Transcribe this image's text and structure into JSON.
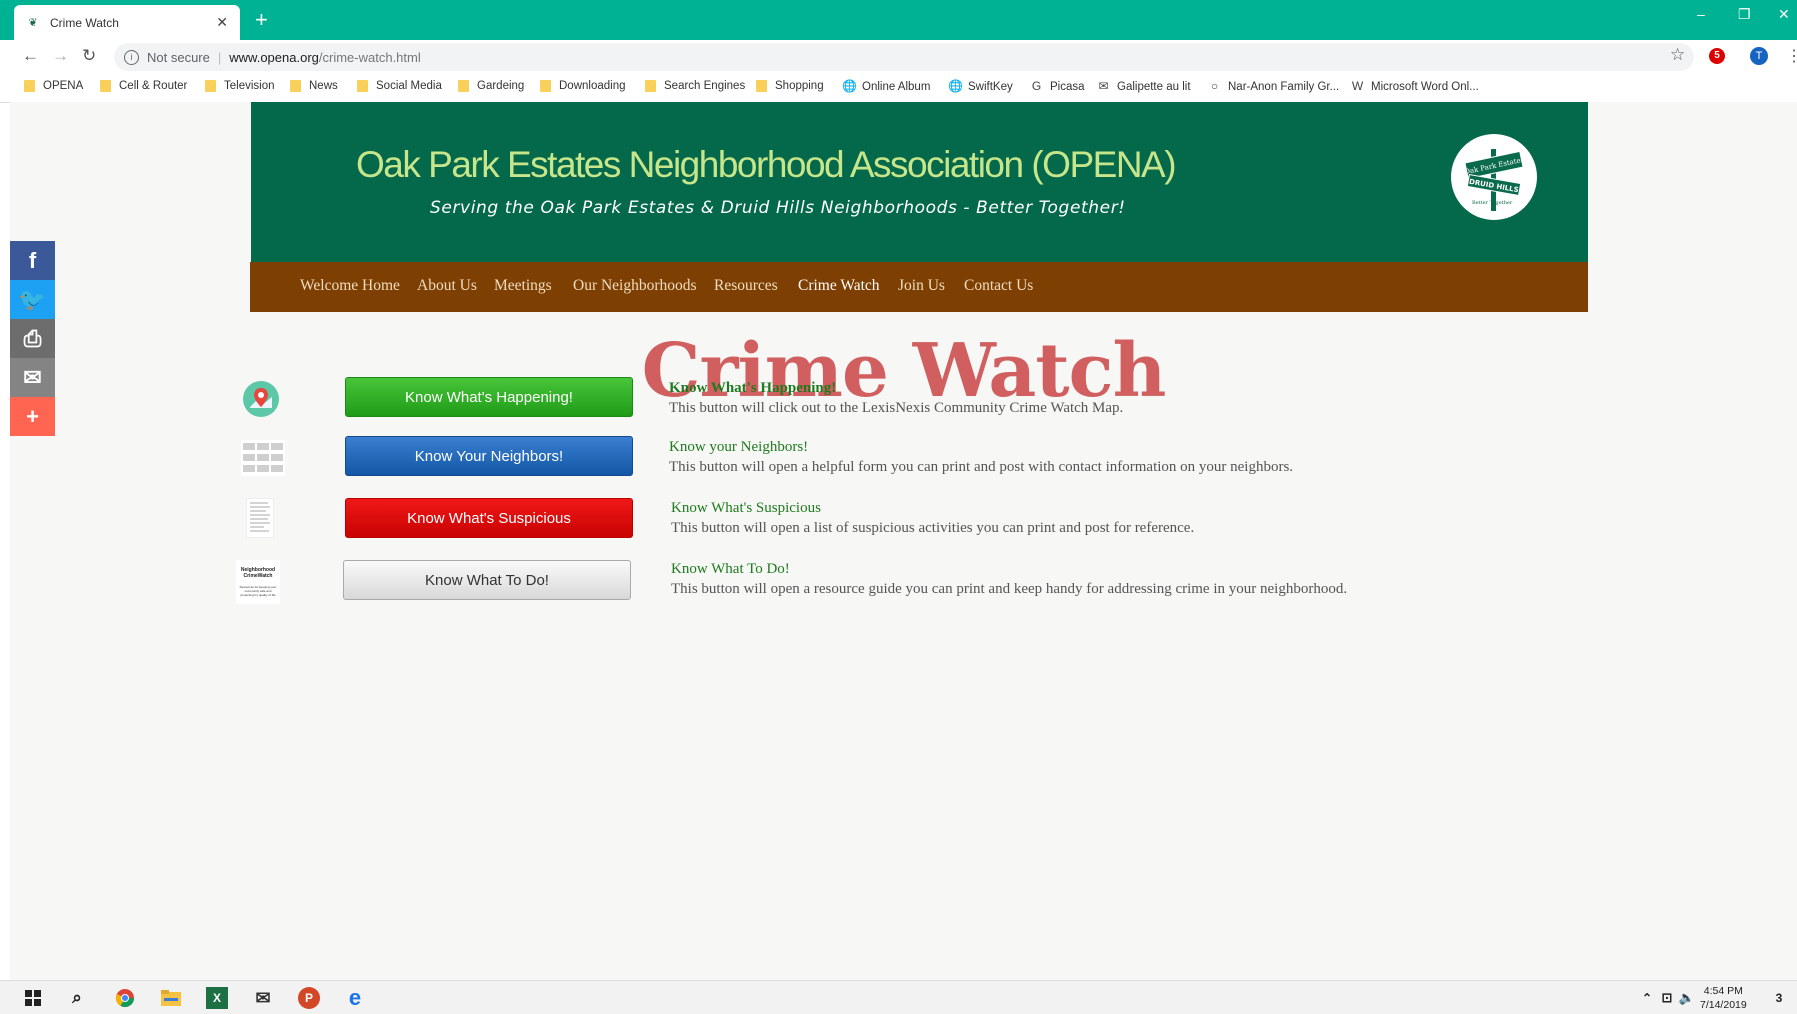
{
  "browser": {
    "tab_title": "Crime Watch",
    "new_tab": "+",
    "omnibox": {
      "security": "Not secure",
      "host": "www.opena.org",
      "path": "/crime-watch.html"
    },
    "profile_initial": "T",
    "ext_badge": "5",
    "bookmarks": [
      {
        "label": "OPENA",
        "icon": "folder"
      },
      {
        "label": "Cell & Router",
        "icon": "folder"
      },
      {
        "label": "Television",
        "icon": "folder"
      },
      {
        "label": "News",
        "icon": "folder"
      },
      {
        "label": "Social Media",
        "icon": "folder"
      },
      {
        "label": "Gardeing",
        "icon": "folder"
      },
      {
        "label": "Downloading",
        "icon": "folder"
      },
      {
        "label": "Search Engines",
        "icon": "folder"
      },
      {
        "label": "Shopping",
        "icon": "folder"
      },
      {
        "label": "Online Album",
        "icon": "globe"
      },
      {
        "label": "SwiftKey",
        "icon": "globe"
      },
      {
        "label": "Picasa",
        "icon": "google"
      },
      {
        "label": "Galipette au lit",
        "icon": "mail"
      },
      {
        "label": "Nar-Anon Family Gr...",
        "icon": "ring"
      },
      {
        "label": "Microsoft Word Onl...",
        "icon": "word"
      }
    ]
  },
  "site": {
    "title": "Oak Park Estates Neighborhood Association (OPENA)",
    "tagline": "Serving the Oak Park Estates & Druid Hills Neighborhoods - Better Together!",
    "logo_text": {
      "top": "Oak Park Estates",
      "middle": "DRUID HILLS",
      "bottom": "Better Together"
    }
  },
  "nav": [
    {
      "label": "Welcome Home",
      "active": false
    },
    {
      "label": "About Us",
      "active": false
    },
    {
      "label": "Meetings",
      "active": false
    },
    {
      "label": "Our Neighborhoods",
      "active": false
    },
    {
      "label": "Resources",
      "active": false
    },
    {
      "label": "Crime Watch",
      "active": true
    },
    {
      "label": "Join Us",
      "active": false
    },
    {
      "label": "Contact Us",
      "active": false
    }
  ],
  "page": {
    "heading": "Crime Watch",
    "rows": [
      {
        "button": "Know What's Happening!",
        "title": "Know What's Happening!",
        "text": "This button will click out to the LexisNexis Community Crime Watch Map.",
        "thumb": "map-pin-icon"
      },
      {
        "button": "Know Your Neighbors!",
        "title": "Know your Neighbors!",
        "text": "This button will open a helpful form you can print and post with contact information on your neighbors.",
        "thumb": "form-thumbnail"
      },
      {
        "button": "Know What's Suspicious",
        "title": "Know What's Suspicious",
        "text": "This button will open a list of suspicious activities you can print and post for reference.",
        "thumb": "document-thumbnail"
      },
      {
        "button": "Know What To Do!",
        "title": "Know What To Do!",
        "text": "This button will open a resource guide you can print and keep handy for addressing crime in your neighborhood.",
        "thumb": "guide-thumbnail"
      }
    ],
    "guide_thumb_text": {
      "title": "Neighborhood CrimeWatch",
      "body": "Resources for keeping your community safe and protecting it's quality of life"
    }
  },
  "share_bar": [
    {
      "icon": "facebook-icon",
      "glyph": "f",
      "color": "#3b5998"
    },
    {
      "icon": "twitter-icon",
      "glyph": "🐦",
      "color": "#1da1f2"
    },
    {
      "icon": "print-icon",
      "glyph": "⎙",
      "color": "#6d6d6d"
    },
    {
      "icon": "email-icon",
      "glyph": "✉",
      "color": "#848484"
    },
    {
      "icon": "more-icon",
      "glyph": "+",
      "color": "#ff6550"
    }
  ],
  "taskbar": {
    "time": "4:54 PM",
    "date": "7/14/2019",
    "notifications": "3"
  },
  "colors": {
    "tabstrip": "#00b294",
    "header": "#04694b",
    "navbar": "#7e3f02",
    "heading": "#d15f5f"
  }
}
